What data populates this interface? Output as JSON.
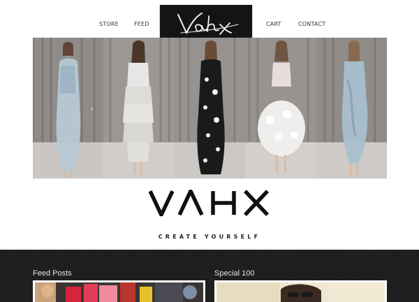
{
  "nav": {
    "store": "STORE",
    "feed": "FEED",
    "cart": "CART",
    "contact": "CONTACT"
  },
  "logo": {
    "script_text": "Vahx"
  },
  "hero": {
    "prev_icon": "chevron-left-icon",
    "next_icon": "chevron-right-icon",
    "prev_glyph": "‹",
    "next_glyph": "›"
  },
  "brand": {
    "wordmark": "VAHX",
    "tagline": "CREATE YOURSELF"
  },
  "sections": {
    "feed_posts_title": "Feed Posts",
    "special_title": "Special 100"
  },
  "colors": {
    "nav_text": "#333333",
    "logo_bg": "#141414",
    "dark_band": "#1c1c1c",
    "section_title": "#e6e6e6"
  }
}
